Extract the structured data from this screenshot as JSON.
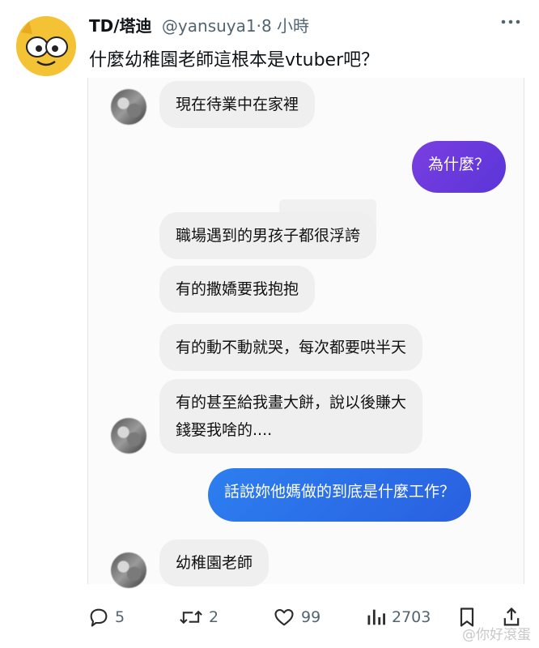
{
  "tweet": {
    "display_name": "TD/塔迪",
    "handle": "@yansuya1",
    "time": "·8 小時",
    "more_icon": "more-horizontal-icon",
    "text": "什麼幼稚園老師這根本是vtuber吧？"
  },
  "chat": {
    "messages": [
      {
        "side": "in",
        "text": "現在待業中在家裡"
      },
      {
        "side": "out",
        "text": "為什麼？"
      },
      {
        "side": "in",
        "text": "職場遇到的男孩子都很浮誇"
      },
      {
        "side": "in",
        "text": "有的撒嬌要我抱抱"
      },
      {
        "side": "in",
        "text": "有的動不動就哭，每次都要哄半天"
      },
      {
        "side": "in",
        "lines": [
          "有的甚至給我畫大餅，說以後賺大",
          "錢娶我啥的...."
        ]
      },
      {
        "side": "out",
        "text": "話說妳他媽做的到底是什麼工作？"
      },
      {
        "side": "in",
        "text": "幼稚園老師"
      }
    ]
  },
  "actions": {
    "reply": {
      "icon": "reply-icon",
      "count": "5"
    },
    "retweet": {
      "icon": "retweet-icon",
      "count": "2"
    },
    "like": {
      "icon": "heart-icon",
      "count": "99"
    },
    "views": {
      "icon": "views-icon",
      "count": "2703"
    },
    "bookmark": {
      "icon": "bookmark-icon"
    },
    "share": {
      "icon": "share-icon"
    }
  },
  "watermark": "@你好滾蛋",
  "colors": {
    "purple_bubble": "#6a3adc",
    "blue_bubble": "#2a6fe8",
    "incoming_bubble": "#efefef",
    "muted_text": "#536471"
  }
}
